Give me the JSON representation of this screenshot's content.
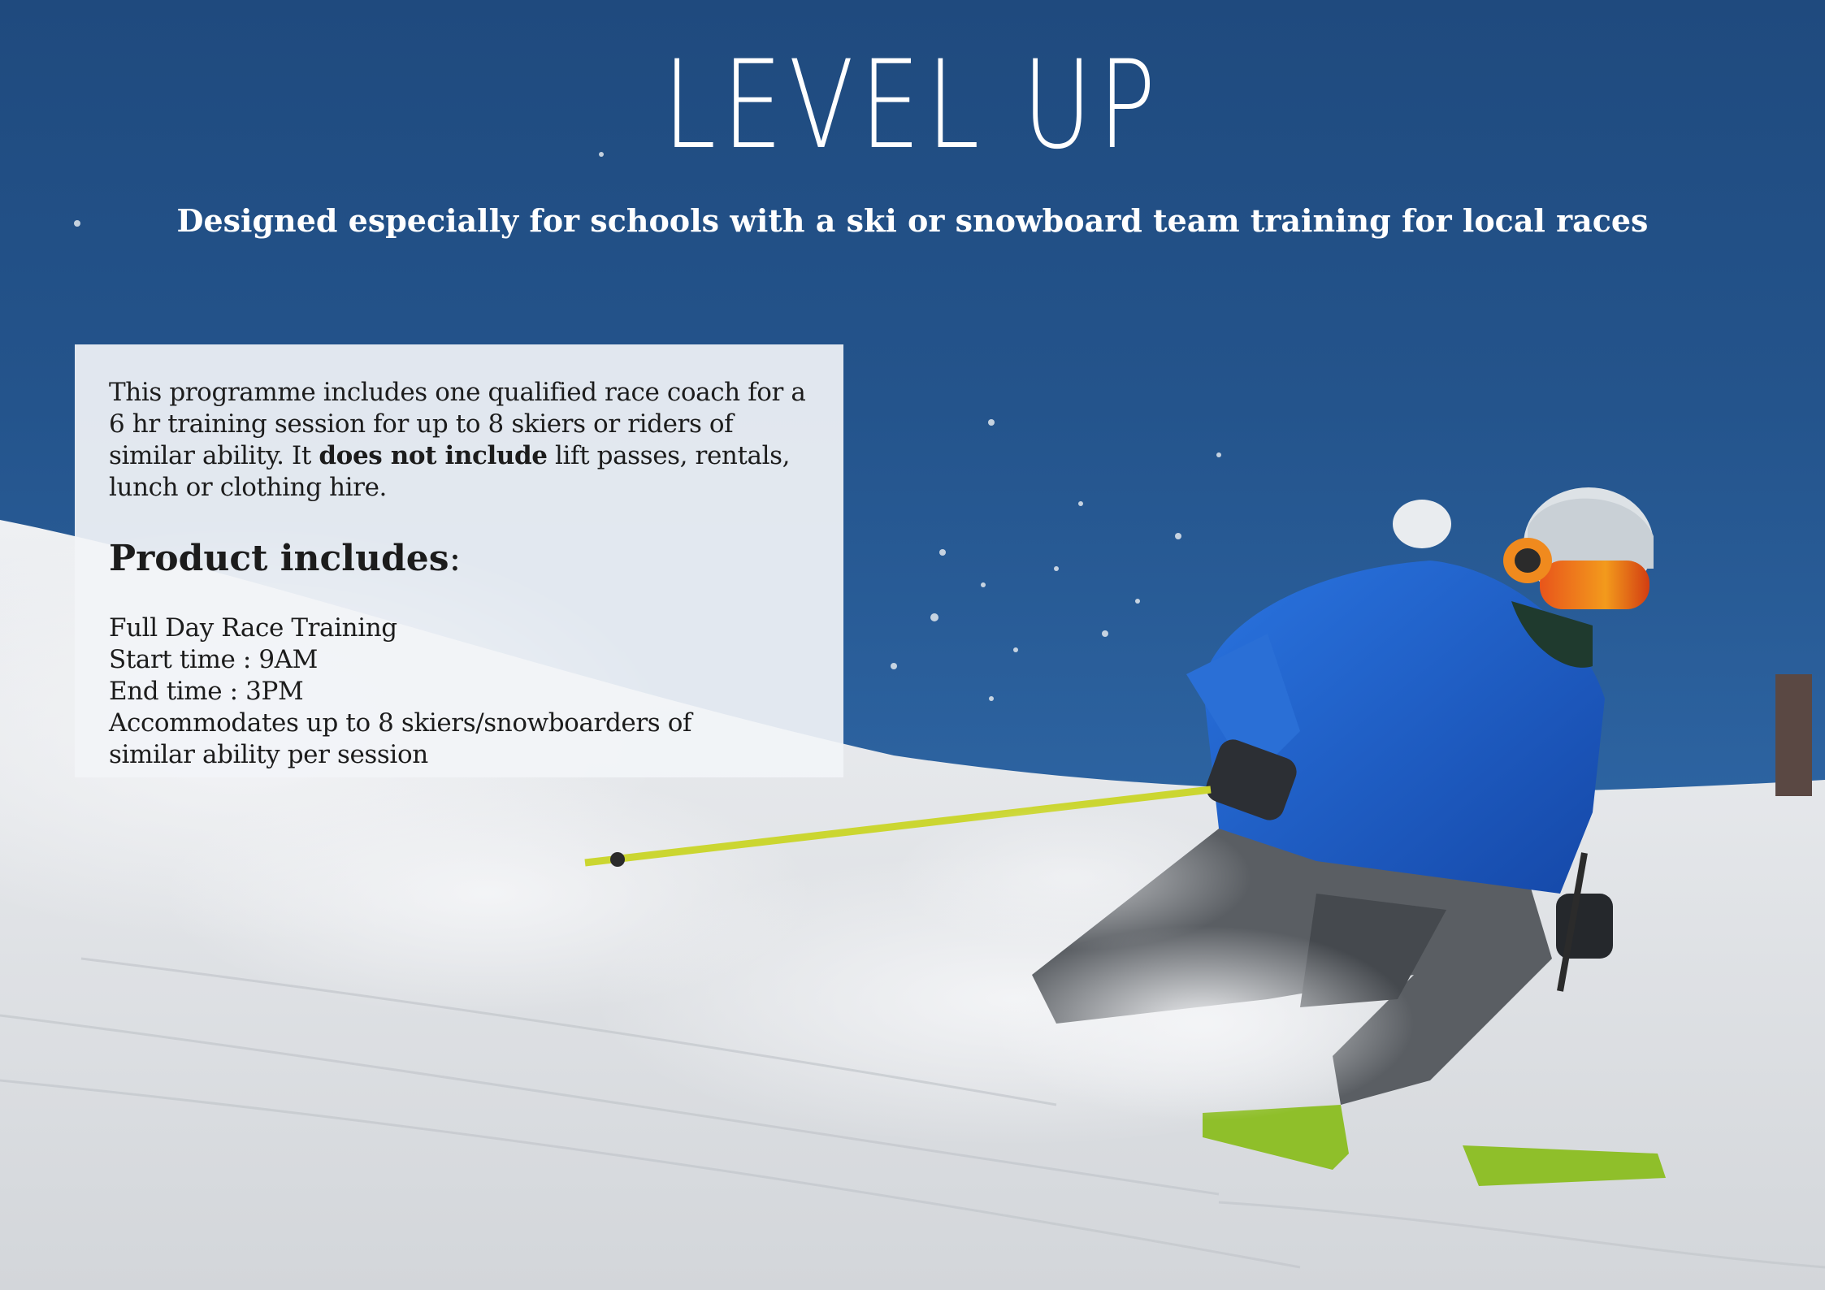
{
  "hero": {
    "title": "LEVEL UP",
    "subtitle": "Designed especially for schools with a ski or snowboard team training for local races",
    "image_description_icon": "skier-photo",
    "colors": {
      "sky": "#23528a",
      "snow": "#e4e6ea",
      "jacket": "#1c5fc8",
      "pole": "#c8d42a",
      "ski": "#8fbf2a"
    }
  },
  "info": {
    "intro_before": "This programme includes one qualified race coach for a 6 hr training session for up to 8 skiers or riders of similar ability. It",
    "intro_bold": "does not include",
    "intro_after": "lift passes, rentals, lunch or clothing hire.",
    "heading": "Product includes",
    "heading_suffix": ":",
    "items": [
      "Full Day Race Training",
      "Start time : 9AM",
      "End time : 3PM",
      "Accommodates up to 8 skiers/snowboarders of similar ability per session"
    ]
  }
}
